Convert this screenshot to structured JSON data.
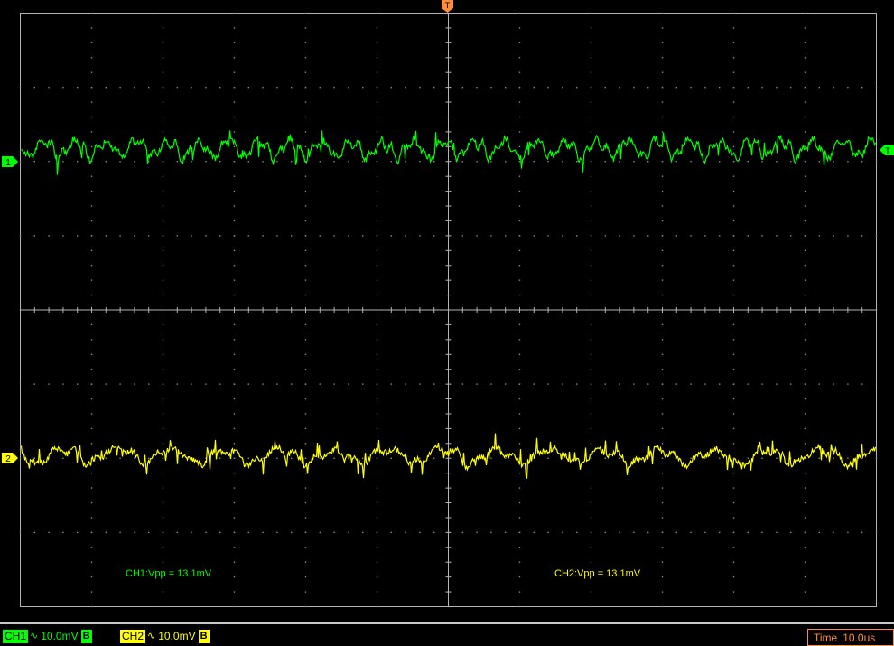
{
  "colors": {
    "ch1": "#00ff00",
    "ch2": "#ffff00",
    "trigger": "#ff8c3c",
    "grid": "#b4b4b4",
    "background": "#000000"
  },
  "markers": {
    "trigger_top": "T",
    "ch1_level": "1",
    "ch2_level": "2",
    "trigger_level": "T"
  },
  "screen": {
    "h_divisions": 12,
    "v_divisions": 8
  },
  "measurements": {
    "ch1": "CH1:Vpp = 13.1mV",
    "ch2": "CH2:Vpp = 13.1mV"
  },
  "status_bar": {
    "ch1": {
      "label": "CH1",
      "coupling_icon": "ac-coupling-icon",
      "coupling_glyph": "∿",
      "scale": "10.0mV",
      "bw": "B"
    },
    "ch2": {
      "label": "CH2",
      "coupling_icon": "ac-coupling-icon",
      "coupling_glyph": "∿",
      "scale": "10.0mV",
      "bw": "B"
    },
    "time": {
      "label": "Time",
      "value": "10.0us"
    }
  }
}
